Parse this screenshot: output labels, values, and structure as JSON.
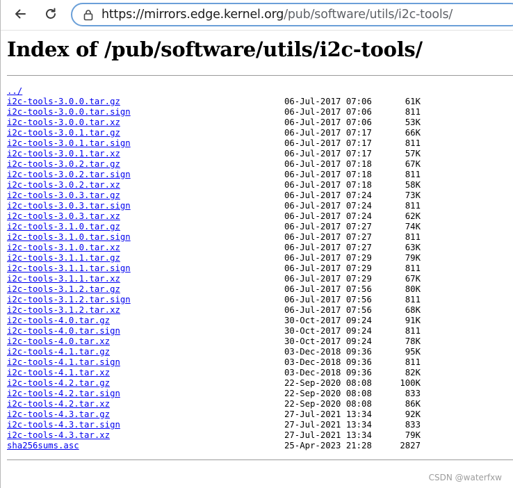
{
  "browser": {
    "url_host": "https://mirrors.edge.kernel.org",
    "url_path": "/pub/software/utils/i2c-tools/",
    "icons": [
      "back-arrow-icon",
      "reload-icon",
      "lock-icon"
    ]
  },
  "page": {
    "title": "Index of /pub/software/utils/i2c-tools/",
    "parent_link": "../",
    "files": [
      {
        "name": "i2c-tools-3.0.0.tar.gz",
        "date": "06-Jul-2017 07:06",
        "size": "61K"
      },
      {
        "name": "i2c-tools-3.0.0.tar.sign",
        "date": "06-Jul-2017 07:06",
        "size": "811"
      },
      {
        "name": "i2c-tools-3.0.0.tar.xz",
        "date": "06-Jul-2017 07:06",
        "size": "53K"
      },
      {
        "name": "i2c-tools-3.0.1.tar.gz",
        "date": "06-Jul-2017 07:17",
        "size": "66K"
      },
      {
        "name": "i2c-tools-3.0.1.tar.sign",
        "date": "06-Jul-2017 07:17",
        "size": "811"
      },
      {
        "name": "i2c-tools-3.0.1.tar.xz",
        "date": "06-Jul-2017 07:17",
        "size": "57K"
      },
      {
        "name": "i2c-tools-3.0.2.tar.gz",
        "date": "06-Jul-2017 07:18",
        "size": "67K"
      },
      {
        "name": "i2c-tools-3.0.2.tar.sign",
        "date": "06-Jul-2017 07:18",
        "size": "811"
      },
      {
        "name": "i2c-tools-3.0.2.tar.xz",
        "date": "06-Jul-2017 07:18",
        "size": "58K"
      },
      {
        "name": "i2c-tools-3.0.3.tar.gz",
        "date": "06-Jul-2017 07:24",
        "size": "73K"
      },
      {
        "name": "i2c-tools-3.0.3.tar.sign",
        "date": "06-Jul-2017 07:24",
        "size": "811"
      },
      {
        "name": "i2c-tools-3.0.3.tar.xz",
        "date": "06-Jul-2017 07:24",
        "size": "62K"
      },
      {
        "name": "i2c-tools-3.1.0.tar.gz",
        "date": "06-Jul-2017 07:27",
        "size": "74K"
      },
      {
        "name": "i2c-tools-3.1.0.tar.sign",
        "date": "06-Jul-2017 07:27",
        "size": "811"
      },
      {
        "name": "i2c-tools-3.1.0.tar.xz",
        "date": "06-Jul-2017 07:27",
        "size": "63K"
      },
      {
        "name": "i2c-tools-3.1.1.tar.gz",
        "date": "06-Jul-2017 07:29",
        "size": "79K"
      },
      {
        "name": "i2c-tools-3.1.1.tar.sign",
        "date": "06-Jul-2017 07:29",
        "size": "811"
      },
      {
        "name": "i2c-tools-3.1.1.tar.xz",
        "date": "06-Jul-2017 07:29",
        "size": "67K"
      },
      {
        "name": "i2c-tools-3.1.2.tar.gz",
        "date": "06-Jul-2017 07:56",
        "size": "80K"
      },
      {
        "name": "i2c-tools-3.1.2.tar.sign",
        "date": "06-Jul-2017 07:56",
        "size": "811"
      },
      {
        "name": "i2c-tools-3.1.2.tar.xz",
        "date": "06-Jul-2017 07:56",
        "size": "68K"
      },
      {
        "name": "i2c-tools-4.0.tar.gz",
        "date": "30-Oct-2017 09:24",
        "size": "91K"
      },
      {
        "name": "i2c-tools-4.0.tar.sign",
        "date": "30-Oct-2017 09:24",
        "size": "811"
      },
      {
        "name": "i2c-tools-4.0.tar.xz",
        "date": "30-Oct-2017 09:24",
        "size": "78K"
      },
      {
        "name": "i2c-tools-4.1.tar.gz",
        "date": "03-Dec-2018 09:36",
        "size": "95K"
      },
      {
        "name": "i2c-tools-4.1.tar.sign",
        "date": "03-Dec-2018 09:36",
        "size": "811"
      },
      {
        "name": "i2c-tools-4.1.tar.xz",
        "date": "03-Dec-2018 09:36",
        "size": "82K"
      },
      {
        "name": "i2c-tools-4.2.tar.gz",
        "date": "22-Sep-2020 08:08",
        "size": "100K"
      },
      {
        "name": "i2c-tools-4.2.tar.sign",
        "date": "22-Sep-2020 08:08",
        "size": "833"
      },
      {
        "name": "i2c-tools-4.2.tar.xz",
        "date": "22-Sep-2020 08:08",
        "size": "86K"
      },
      {
        "name": "i2c-tools-4.3.tar.gz",
        "date": "27-Jul-2021 13:34",
        "size": "92K"
      },
      {
        "name": "i2c-tools-4.3.tar.sign",
        "date": "27-Jul-2021 13:34",
        "size": "833"
      },
      {
        "name": "i2c-tools-4.3.tar.xz",
        "date": "27-Jul-2021 13:34",
        "size": "79K"
      },
      {
        "name": "sha256sums.asc",
        "date": "25-Apr-2023 21:28",
        "size": "2827"
      }
    ]
  },
  "watermark": "CSDN @waterfxw"
}
